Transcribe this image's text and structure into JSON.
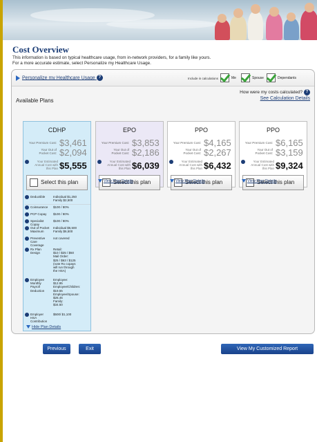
{
  "header": {
    "title": "Cost Overview"
  },
  "intro": {
    "line1": "This information is based on typical healthcare usage, from in-network providers, for a family like yours.",
    "line2": "For a more accurate estimate, select Personalize my Healthcare Usage."
  },
  "personalize": {
    "link": "Personalize my Healthcare Usage",
    "q": "?"
  },
  "include": {
    "label": "Include in calculations",
    "items": [
      {
        "label": "Me",
        "checked": true
      },
      {
        "label": "Spouse",
        "checked": true
      },
      {
        "label": "Dependants",
        "checked": true
      }
    ]
  },
  "calc": {
    "question": "How were my costs calculated?",
    "link": "See Calculation Details",
    "q": "?"
  },
  "available_plans_label": "Available Plans",
  "cost_labels": {
    "premium": "Your Premium Cost:",
    "oop1": "Your Out of",
    "oop2": "Pocket Cost:",
    "est1": "Your Estimated",
    "est2": "Annual Cost with",
    "est3": "this Plan"
  },
  "select_label": "Select this plan",
  "view_details": "View Plan Details",
  "hide_details": "Hide Plan Details",
  "plans": [
    {
      "name": "CDHP",
      "premium": "$3,461",
      "oop": "$2,094",
      "estimated": "$5,555"
    },
    {
      "name": "EPO",
      "premium": "$3,853",
      "oop": "$2,186",
      "estimated": "$6,039"
    },
    {
      "name": "PPO",
      "premium": "$4,165",
      "oop": "$2,267",
      "estimated": "$6,432"
    },
    {
      "name": "PPO",
      "premium": "$6,165",
      "oop": "$3,159",
      "estimated": "$9,324"
    }
  ],
  "details": {
    "deductible": {
      "label": "Deductible",
      "ind_label": "Individual",
      "ind_val": "$1,250",
      "fam_label": "Family",
      "fam_val": "$2,500"
    },
    "coinsurance": {
      "label": "Coinsurance",
      "value": "$100 / 80%"
    },
    "pcp": {
      "label": "PCP Copay",
      "value": "$100 / 80%"
    },
    "specialist": {
      "label": "Specialist Copay",
      "value": "$100 / 80%"
    },
    "oop_max": {
      "label1": "Out of Pocket",
      "label2": "Maximum",
      "ind_label": "Individual",
      "ind_val": "$5,500",
      "fam_label": "Family",
      "fam_val": "$6,500"
    },
    "preventive": {
      "label1": "Preventive Care",
      "label2": "Coverage",
      "value": "not covered"
    },
    "rx": {
      "label": "Rx Plan Design",
      "lines": [
        "Retail:",
        "$10 / $25 / $50",
        "Mail Order:",
        "$25 / $63 / $125",
        "(note Rx copays",
        "will run through",
        "the HSA)"
      ]
    },
    "payroll": {
      "label1": "Employee Monthly",
      "label2": "Payroll Deduction",
      "lines": [
        "Employee:",
        "$12.95",
        "Employee/Children:",
        "$19.55",
        "Employee/Spouse:",
        "$26.45",
        "Family:",
        "$34.50"
      ]
    },
    "hsa": {
      "label1": "Employer",
      "label2": "HSA Contribution",
      "value": "$500/ $1,100"
    }
  },
  "buttons": {
    "previous": "Previous",
    "exit": "Exit",
    "report": "View My Customized Report"
  }
}
